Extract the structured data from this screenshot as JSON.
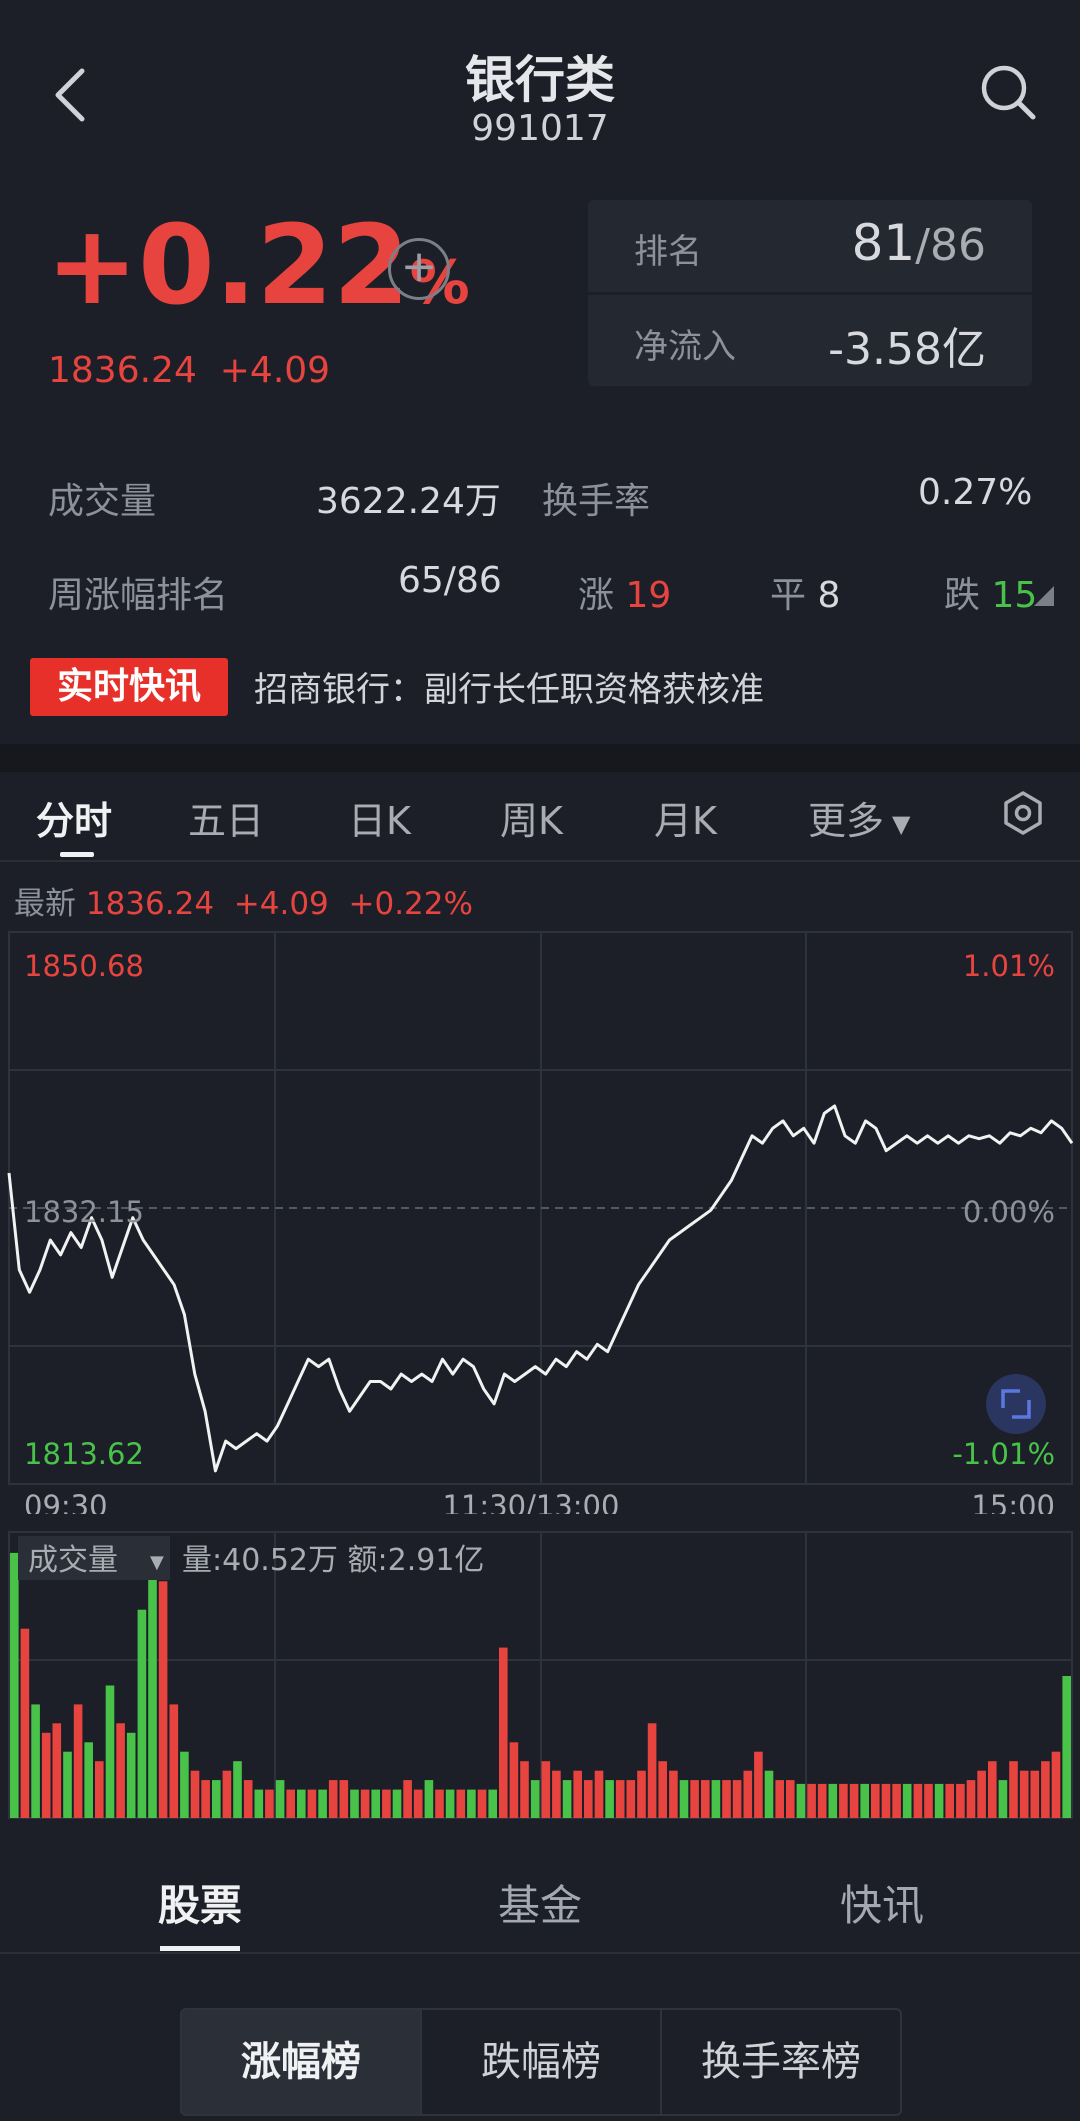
{
  "header": {
    "title": "银行类",
    "code": "991017"
  },
  "quote": {
    "change_pct": "+0.22",
    "pct_suffix": "%",
    "price": "1836.24",
    "change": "+4.09",
    "rank_label": "排名",
    "rank_value": "81",
    "rank_total": "/86",
    "netflow_label": "净流入",
    "netflow_value": "-3.58亿"
  },
  "stats": {
    "volume_label": "成交量",
    "volume_value": "3622.24万",
    "turnover_label": "换手率",
    "turnover_value": "0.27%",
    "week_rank_label": "周涨幅排名",
    "week_rank_value": "65/86",
    "up_label": "涨",
    "up_count": "19",
    "flat_label": "平",
    "flat_count": "8",
    "down_label": "跌",
    "down_count": "15"
  },
  "news": {
    "tag": "实时快讯",
    "text": "招商银行：副行长任职资格获核准"
  },
  "period_tabs": [
    "分时",
    "五日",
    "日K",
    "周K",
    "月K",
    "更多"
  ],
  "latest": {
    "label": "最新",
    "price": "1836.24",
    "change": "+4.09",
    "pct": "+0.22%"
  },
  "colors": {
    "up": "#e8443f",
    "down": "#49c24a",
    "bg": "#1c1f27"
  },
  "chart_data": {
    "type": "line",
    "y_labels": {
      "top": "1850.68",
      "mid": "1832.15",
      "bottom": "1813.62"
    },
    "pct_labels": {
      "top": "1.01%",
      "mid": "0.00%",
      "bottom": "-1.01%"
    },
    "x_labels": [
      "09:30",
      "11:30/13:00",
      "15:00"
    ],
    "ylim": [
      1813.62,
      1850.68
    ],
    "baseline": 1832.15,
    "values": [
      1834.5,
      1828,
      1826.5,
      1828,
      1830,
      1829,
      1830.5,
      1829.5,
      1831.5,
      1830,
      1827.5,
      1829.5,
      1831.5,
      1830,
      1829,
      1828,
      1827,
      1825,
      1821,
      1818.5,
      1814.5,
      1816.5,
      1816,
      1816.5,
      1817,
      1816.5,
      1817.5,
      1819,
      1820.5,
      1822,
      1821.5,
      1822,
      1820,
      1818.5,
      1819.5,
      1820.5,
      1820.5,
      1820,
      1821,
      1820.5,
      1821,
      1820.5,
      1822,
      1821,
      1822,
      1821.5,
      1820,
      1819,
      1821,
      1820.5,
      1821,
      1821.5,
      1821,
      1822,
      1821.5,
      1822.5,
      1822,
      1823,
      1822.5,
      1824,
      1825.5,
      1827,
      1828,
      1829,
      1830,
      1830.5,
      1831,
      1831.5,
      1832,
      1833,
      1834,
      1835.5,
      1837,
      1836.5,
      1837.5,
      1838,
      1837,
      1837.5,
      1836.5,
      1838.5,
      1839,
      1837,
      1836.5,
      1838,
      1837.5,
      1836,
      1836.5,
      1837,
      1836.5,
      1837,
      1836.5,
      1837,
      1836.5,
      1837,
      1836.8,
      1837,
      1836.5,
      1837.2,
      1837,
      1837.5,
      1837.2,
      1838,
      1837.5,
      1836.5
    ],
    "volume": {
      "label": "成交量",
      "summary": "量:40.52万 额:2.91亿",
      "bars": [
        {
          "v": 14.0,
          "up": false
        },
        {
          "v": 10.0,
          "up": true
        },
        {
          "v": 6.0,
          "up": false
        },
        {
          "v": 4.5,
          "up": true
        },
        {
          "v": 5.0,
          "up": true
        },
        {
          "v": 3.5,
          "up": false
        },
        {
          "v": 6.0,
          "up": true
        },
        {
          "v": 4.0,
          "up": false
        },
        {
          "v": 3.0,
          "up": true
        },
        {
          "v": 7.0,
          "up": false
        },
        {
          "v": 5.0,
          "up": true
        },
        {
          "v": 4.5,
          "up": false
        },
        {
          "v": 11.0,
          "up": false
        },
        {
          "v": 14.0,
          "up": false
        },
        {
          "v": 12.5,
          "up": true
        },
        {
          "v": 6.0,
          "up": true
        },
        {
          "v": 3.5,
          "up": false
        },
        {
          "v": 2.5,
          "up": true
        },
        {
          "v": 2.0,
          "up": true
        },
        {
          "v": 2.0,
          "up": false
        },
        {
          "v": 2.5,
          "up": true
        },
        {
          "v": 3.0,
          "up": false
        },
        {
          "v": 2.0,
          "up": true
        },
        {
          "v": 1.5,
          "up": false
        },
        {
          "v": 1.5,
          "up": true
        },
        {
          "v": 2.0,
          "up": false
        },
        {
          "v": 1.5,
          "up": true
        },
        {
          "v": 1.5,
          "up": false
        },
        {
          "v": 1.5,
          "up": true
        },
        {
          "v": 1.5,
          "up": false
        },
        {
          "v": 2.0,
          "up": true
        },
        {
          "v": 2.0,
          "up": true
        },
        {
          "v": 1.5,
          "up": false
        },
        {
          "v": 1.5,
          "up": true
        },
        {
          "v": 1.5,
          "up": false
        },
        {
          "v": 1.5,
          "up": true
        },
        {
          "v": 1.5,
          "up": false
        },
        {
          "v": 2.0,
          "up": true
        },
        {
          "v": 1.5,
          "up": true
        },
        {
          "v": 2.0,
          "up": false
        },
        {
          "v": 1.5,
          "up": true
        },
        {
          "v": 1.5,
          "up": false
        },
        {
          "v": 1.5,
          "up": true
        },
        {
          "v": 1.5,
          "up": false
        },
        {
          "v": 1.5,
          "up": true
        },
        {
          "v": 1.5,
          "up": false
        },
        {
          "v": 9.0,
          "up": true
        },
        {
          "v": 4.0,
          "up": true
        },
        {
          "v": 3.0,
          "up": true
        },
        {
          "v": 2.0,
          "up": false
        },
        {
          "v": 3.0,
          "up": true
        },
        {
          "v": 2.5,
          "up": true
        },
        {
          "v": 2.0,
          "up": false
        },
        {
          "v": 2.5,
          "up": true
        },
        {
          "v": 2.0,
          "up": true
        },
        {
          "v": 2.5,
          "up": true
        },
        {
          "v": 2.0,
          "up": false
        },
        {
          "v": 2.0,
          "up": true
        },
        {
          "v": 2.0,
          "up": true
        },
        {
          "v": 2.5,
          "up": true
        },
        {
          "v": 5.0,
          "up": true
        },
        {
          "v": 3.0,
          "up": true
        },
        {
          "v": 2.5,
          "up": true
        },
        {
          "v": 2.0,
          "up": false
        },
        {
          "v": 2.0,
          "up": true
        },
        {
          "v": 2.0,
          "up": true
        },
        {
          "v": 2.0,
          "up": false
        },
        {
          "v": 2.0,
          "up": true
        },
        {
          "v": 2.0,
          "up": true
        },
        {
          "v": 2.5,
          "up": true
        },
        {
          "v": 3.5,
          "up": true
        },
        {
          "v": 2.5,
          "up": false
        },
        {
          "v": 2.0,
          "up": true
        },
        {
          "v": 2.0,
          "up": true
        },
        {
          "v": 1.8,
          "up": false
        },
        {
          "v": 1.8,
          "up": true
        },
        {
          "v": 1.8,
          "up": true
        },
        {
          "v": 1.8,
          "up": false
        },
        {
          "v": 1.8,
          "up": true
        },
        {
          "v": 1.8,
          "up": true
        },
        {
          "v": 1.8,
          "up": false
        },
        {
          "v": 1.8,
          "up": true
        },
        {
          "v": 1.8,
          "up": true
        },
        {
          "v": 1.8,
          "up": true
        },
        {
          "v": 1.8,
          "up": false
        },
        {
          "v": 1.8,
          "up": true
        },
        {
          "v": 1.8,
          "up": true
        },
        {
          "v": 1.8,
          "up": false
        },
        {
          "v": 1.8,
          "up": true
        },
        {
          "v": 1.8,
          "up": true
        },
        {
          "v": 2.0,
          "up": true
        },
        {
          "v": 2.5,
          "up": true
        },
        {
          "v": 3.0,
          "up": true
        },
        {
          "v": 2.0,
          "up": false
        },
        {
          "v": 3.0,
          "up": true
        },
        {
          "v": 2.5,
          "up": true
        },
        {
          "v": 2.5,
          "up": true
        },
        {
          "v": 3.0,
          "up": true
        },
        {
          "v": 3.5,
          "up": true
        },
        {
          "v": 7.5,
          "up": false
        }
      ]
    }
  },
  "bottom_tabs": [
    "股票",
    "基金",
    "快讯"
  ],
  "segments": [
    "涨幅榜",
    "跌幅榜",
    "换手率榜"
  ]
}
